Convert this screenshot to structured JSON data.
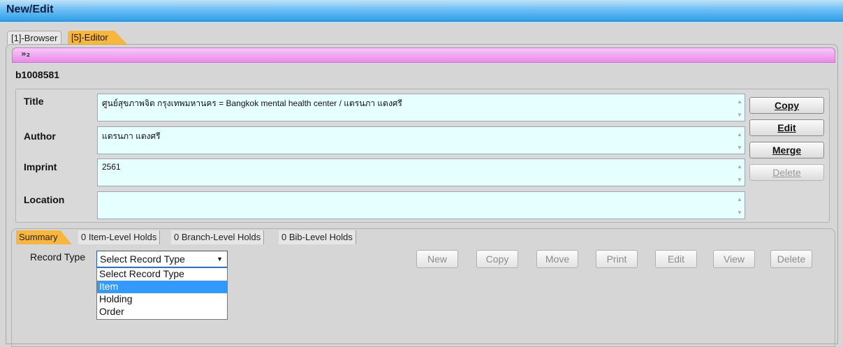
{
  "window": {
    "title": "New/Edit"
  },
  "outer_tabs": [
    "[1]-Browser",
    "[5]-Editor"
  ],
  "header": {
    "marker": "»₂"
  },
  "record_id": "b1008581",
  "fields": [
    {
      "label": "Title",
      "value": "ศูนย์สุขภาพจิต กรุงเทพมหานคร = Bangkok mental health center / แตรนภา แตงศรี"
    },
    {
      "label": "Author",
      "value": "แตรนภา แตงศรี"
    },
    {
      "label": "Imprint",
      "value": "2561"
    },
    {
      "label": "Location",
      "value": ""
    }
  ],
  "side_buttons": [
    "Copy",
    "Edit",
    "Merge",
    "Delete"
  ],
  "lower_tabs": [
    "Summary",
    "0 Item-Level Holds",
    "0 Branch-Level Holds",
    "0 Bib-Level Holds"
  ],
  "record_type": {
    "label": "Record Type",
    "selected": "Select Record Type",
    "options": [
      "Select Record Type",
      "Item",
      "Holding",
      "Order"
    ],
    "highlighted": "Item"
  },
  "action_buttons": [
    "New",
    "Copy",
    "Move",
    "Print",
    "Edit",
    "View",
    "Delete"
  ],
  "colors": {
    "titlebar": "#2f9ee8",
    "active_tab": "#f6b73c",
    "pink_bar": "#e98ae9",
    "field_bg": "#e6ffff",
    "highlight": "#3399ff"
  }
}
